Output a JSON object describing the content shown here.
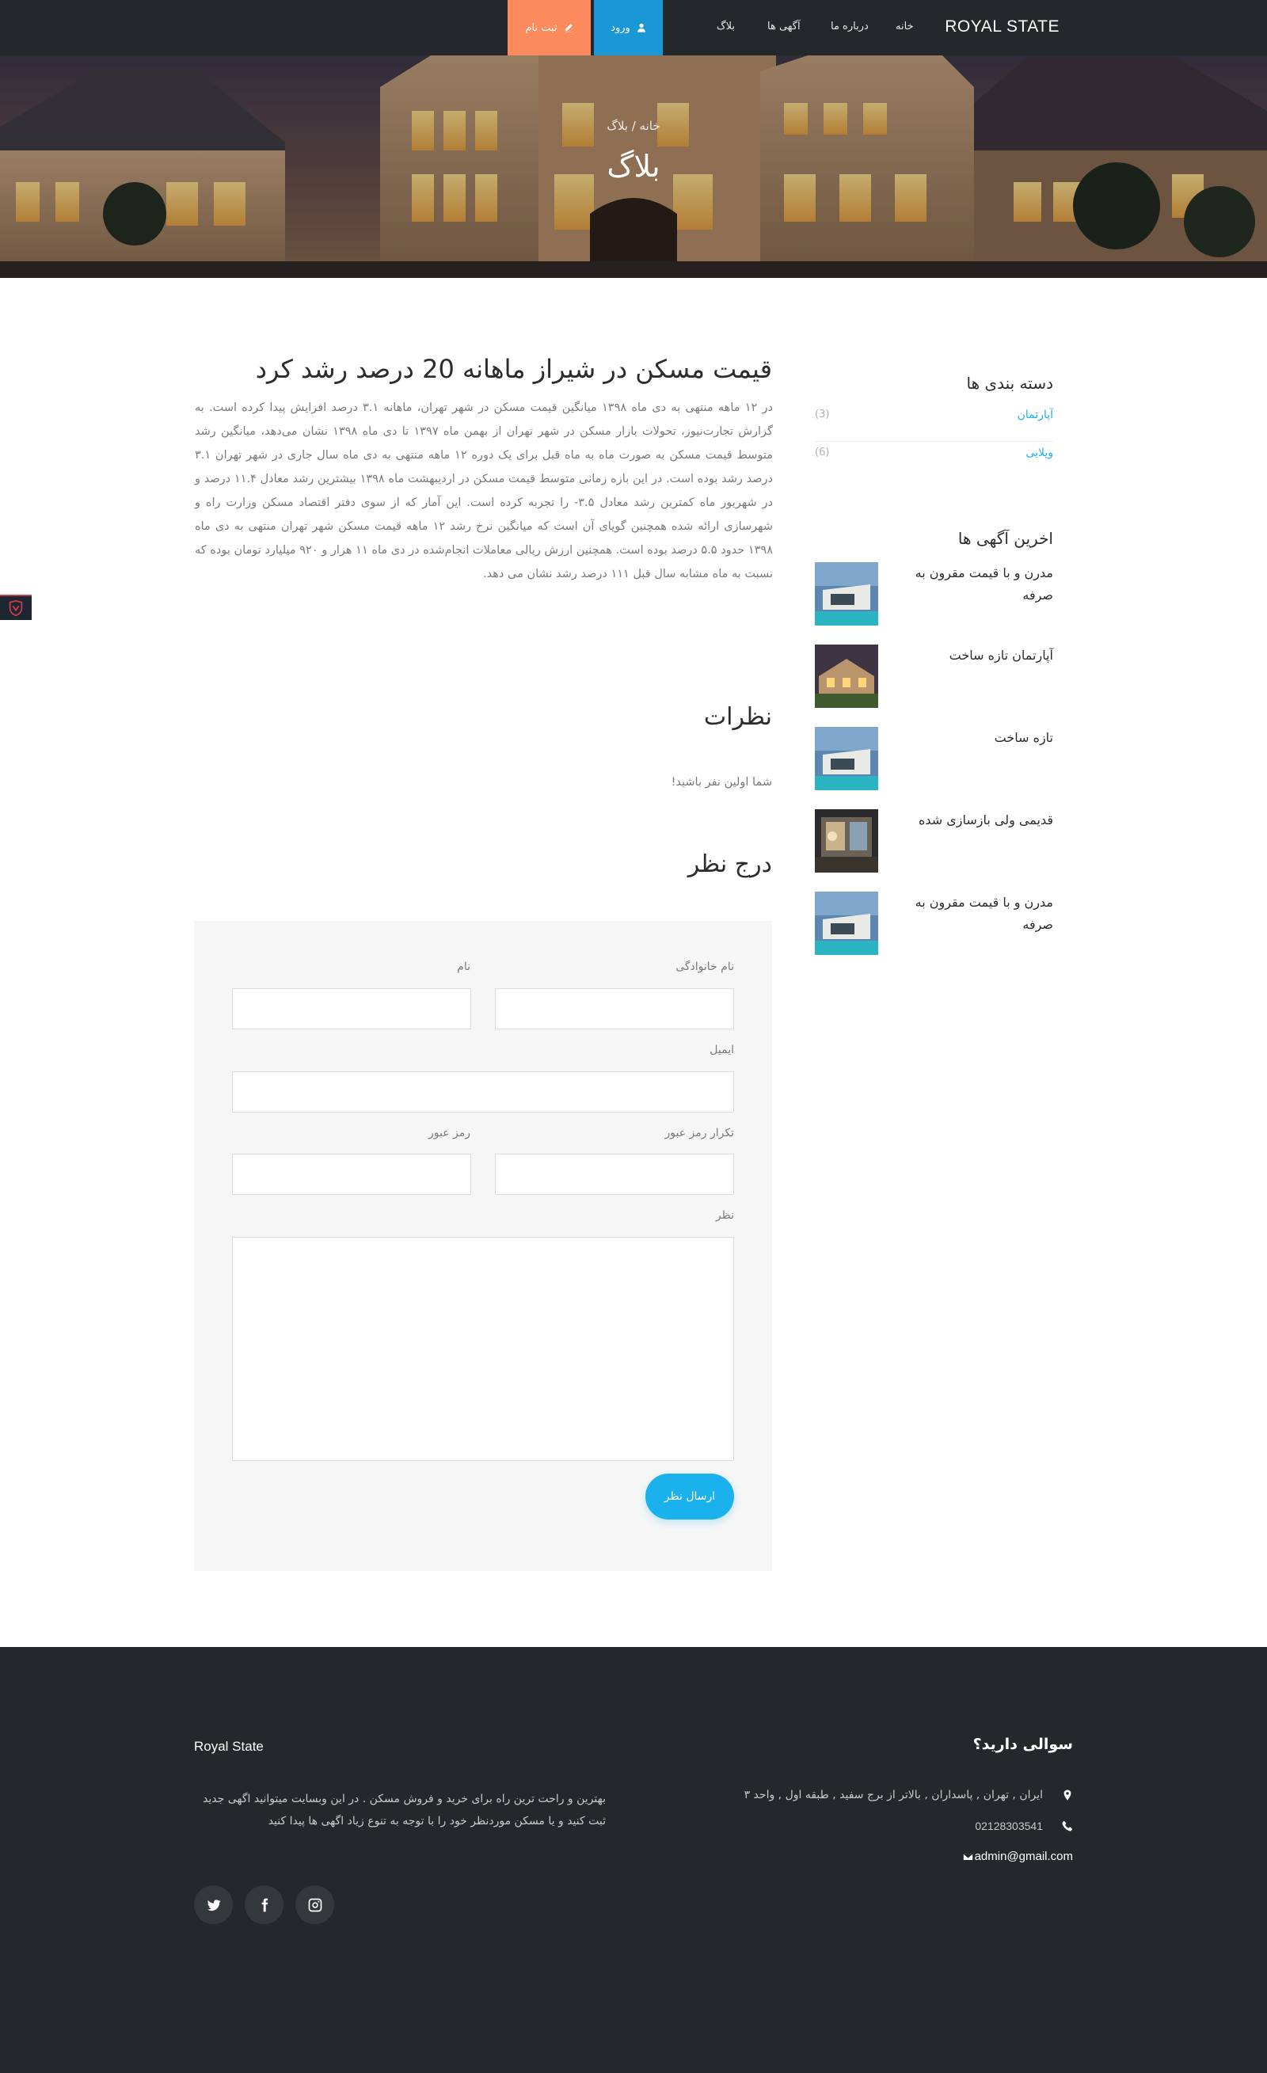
{
  "navbar": {
    "brand": "ROYAL STATE",
    "items": [
      {
        "label": "خانه"
      },
      {
        "label": "درباره ما"
      },
      {
        "label": "آگهی ها"
      },
      {
        "label": "بلاگ"
      }
    ],
    "login_label": "ورود",
    "register_label": "ثبت نام",
    "login_color": "#1998d5",
    "register_color": "#fb8a5c",
    "login_icon": "user-icon",
    "register_icon": "pencil-icon"
  },
  "hero": {
    "breadcrumb": "خانه / بلاگ",
    "title": "بلاگ"
  },
  "article": {
    "title": "قیمت مسکن در شیراز ماهانه 20 درصد رشد کرد",
    "body": "در ۱۲ ماهه منتهی به دی ماه ۱۳۹۸ میانگین قیمت مسکن در شهر تهران، ماهانه ۳.۱ درصد افزایش پیدا کرده است. به گزارش تجارت‌نیوز، تحولات بازار مسکن در شهر تهران از بهمن ماه ۱۳۹۷ تا دی ماه ۱۳۹۸ نشان می‌دهد، میانگین رشد متوسط قیمت مسکن به صورت ماه به ماه قبل برای یک دوره ۱۲ ماهه منتهی به دی ماه سال جاری در شهر تهران ۳.۱ درصد رشد بوده است. در این بازه زمانی متوسط قیمت مسکن در اردیبهشت ماه ۱۳۹۸ بیشترین رشد معادل ۱۱.۴ درصد و در شهریور ماه کمترین رشد معادل ۳.۵- را تجربه کرده است. این آمار که از سوی دفتر اقتصاد مسکن وزارت راه و شهرسازی ارائه شده همچنین گویای آن است که میانگین نرخ رشد ۱۲ ماهه قیمت مسکن شهر تهران منتهی به دی ماه ۱۳۹۸ حدود ۵.۵ درصد بوده است. همچنین ارزش ریالی معاملات انجام‌شده در دی ماه ۱۱ هزار و ۹۲۰ میلیارد تومان بوده که نسبت به ماه مشابه سال قبل ۱۱۱ درصد رشد نشان می دهد."
  },
  "comments": {
    "heading": "نظرات",
    "empty_text": "شما اولین نفر باشید!"
  },
  "comment_form": {
    "heading": "درج نظر",
    "first_name_label": "نام",
    "last_name_label": "نام خانوادگی",
    "email_label": "ایمیل",
    "password_label": "رمز عبور",
    "password_confirm_label": "تکرار رمز عبور",
    "comment_label": "نظر",
    "submit_label": "ارسال نظر",
    "submit_color": "#1ab1ec"
  },
  "sidebar": {
    "categories_heading": "دسته بندی ها",
    "categories": [
      {
        "name": "آپارتمان",
        "count": "(3)"
      },
      {
        "name": "ویلایی",
        "count": "(6)"
      }
    ],
    "latest_heading": "اخرین آگهی ها",
    "listings": [
      {
        "title": "مدرن و با قیمت مقرون به صرفه"
      },
      {
        "title": "آپارتمان تازه ساخت"
      },
      {
        "title": "تازه ساخت"
      },
      {
        "title": "قدیمی ولی بازسازی شده"
      },
      {
        "title": "مدرن و با قیمت مقرون به صرفه"
      }
    ]
  },
  "footer": {
    "brand": "Royal State",
    "description": "بهترین و راحت ترین راه برای خرید و فروش مسکن . در این وبسایت میتوانید اگهی جدید ثبت کنید و یا مسکن موردنظر خود را با توجه به تنوع زیاد اگهی ها پیدا کنید",
    "question_heading": "سوالی دارید؟",
    "address": "ایران , تهران , پاسداران , بالاتر از برج سفید , طبقه اول , واحد ۳",
    "phone": "02128303541",
    "email": "admin@gmail.com",
    "social_icons": [
      "twitter-icon",
      "facebook-icon",
      "instagram-icon"
    ]
  }
}
